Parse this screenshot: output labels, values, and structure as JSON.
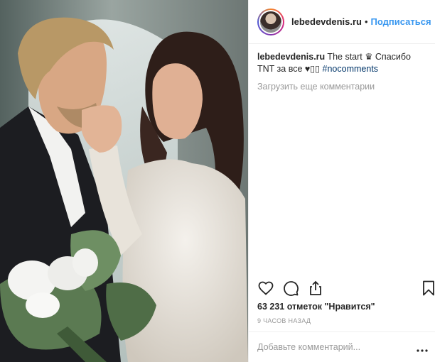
{
  "post": {
    "image_alt": "",
    "colors": {
      "link": "#3897f0",
      "hashtag": "#003569",
      "muted": "#999999",
      "text": "#262626"
    }
  },
  "header": {
    "username": "lebedevdenis.ru",
    "separator": "•",
    "follow_label": "Подписаться"
  },
  "caption": {
    "username": "lebedevdenis.ru",
    "text_part1": " The start ♛ Спасибо TNT за все ♥▯▯ ",
    "hashtag": "#nocomments"
  },
  "comments": {
    "load_more_label": "Загрузить еще комментарии"
  },
  "actions": {
    "icons": [
      "heart-icon",
      "comment-icon",
      "share-icon",
      "bookmark-icon"
    ]
  },
  "likes": {
    "label": "63 231 отметок \"Нравится\""
  },
  "time": {
    "label": "9 часов назад"
  },
  "add_comment": {
    "placeholder": "Добавьте комментарий...",
    "more_icon": "more-dots-icon"
  }
}
